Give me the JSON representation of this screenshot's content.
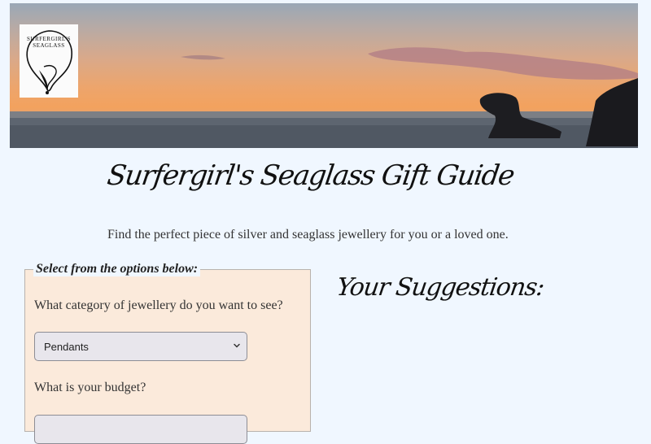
{
  "header": {
    "banner_image": "sunset-sea-banner",
    "logo": {
      "text": "SURFERGIRL'S SEAGLASS"
    }
  },
  "page": {
    "title": "Surfergirl's Seaglass Gift Guide",
    "intro": "Find the perfect piece of silver and seaglass jewellery for you or a loved one."
  },
  "options": {
    "legend": "Select from the options below:",
    "category_question": "What category of jewellery do you want to see?",
    "category_selected": "Pendants",
    "budget_question": "What is your budget?",
    "budget_selected": ""
  },
  "suggestions": {
    "title": "Your Suggestions:"
  },
  "colors": {
    "page_background": "#f0f7ff",
    "panel_background": "#fbeadb",
    "select_background": "#e8e6ec"
  }
}
